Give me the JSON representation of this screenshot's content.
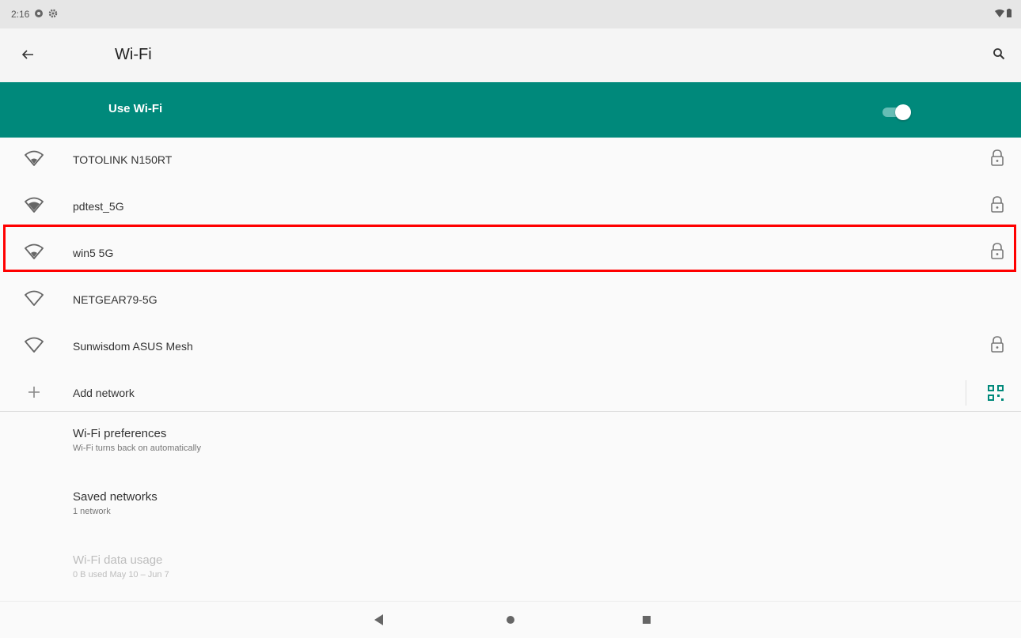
{
  "status_bar": {
    "time": "2:16",
    "icons": [
      "sync-icon",
      "settings-gear-icon"
    ],
    "right_icons": [
      "wifi-signal-icon",
      "battery-icon"
    ]
  },
  "app_bar": {
    "title": "Wi-Fi",
    "back_icon": "arrow-back-icon",
    "search_icon": "search-icon"
  },
  "master_switch": {
    "label": "Use Wi-Fi",
    "state": "on",
    "accent_color": "#00897b"
  },
  "networks": [
    {
      "name": "TOTOLINK N150RT",
      "secured": true
    },
    {
      "name": "pdtest_5G",
      "secured": true
    },
    {
      "name": "win5 5G",
      "secured": true,
      "highlighted": true
    },
    {
      "name": "NETGEAR79-5G",
      "secured": false
    },
    {
      "name": "Sunwisdom ASUS Mesh",
      "secured": true
    }
  ],
  "add_network": {
    "label": "Add network",
    "qr_icon": "qr-code-scan-icon"
  },
  "preferences": [
    {
      "title": "Wi-Fi preferences",
      "summary": "Wi-Fi turns back on automatically",
      "enabled": true
    },
    {
      "title": "Saved networks",
      "summary": "1 network",
      "enabled": true
    },
    {
      "title": "Wi-Fi data usage",
      "summary": "0 B used May 10 – Jun 7",
      "enabled": false
    }
  ],
  "nav_bar": {
    "buttons": [
      "back-triangle-icon",
      "home-circle-icon",
      "recents-square-icon"
    ]
  },
  "highlight_color": "#ff0000"
}
